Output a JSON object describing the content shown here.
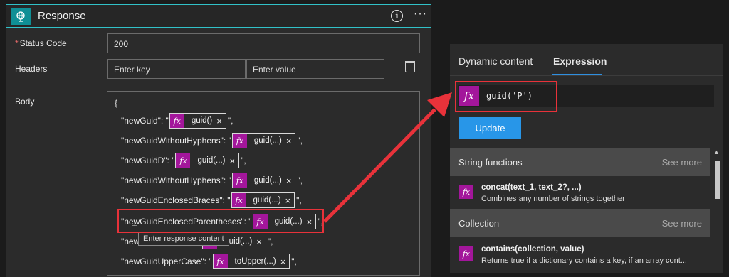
{
  "response_card": {
    "title": "Response",
    "info_label": "i",
    "more_label": "···",
    "status_code": {
      "label": "Status Code",
      "required_mark": "*",
      "value": "200"
    },
    "headers": {
      "label": "Headers",
      "key_placeholder": "Enter key",
      "value_placeholder": "Enter value"
    },
    "body": {
      "label": "Body",
      "open_brace": "{",
      "lines": [
        {
          "key": "\"newGuid\": \"",
          "token": "guid()",
          "suffix": "\","
        },
        {
          "key": "\"newGuidWithoutHyphens\": \"",
          "token": "guid(...)",
          "suffix": "\","
        },
        {
          "key": "\"newGuidD\": \"",
          "token": "guid(...)",
          "suffix": "\","
        },
        {
          "key": "\"newGuidWithoutHyphens\": \"",
          "token": "guid(...)",
          "suffix": "\","
        },
        {
          "key": "\"newGuidEnclosedBraces\": \"",
          "token": "guid(...)",
          "suffix": "\","
        },
        {
          "key": "\"newGuidEnclosedParentheses\": \"",
          "token": "guid(...)",
          "suffix": "\","
        },
        {
          "key": "\"new",
          "token": "guid(...)",
          "suffix": "\","
        },
        {
          "key": "\"newGuidUpperCase\": \"",
          "token": "toUpper(...)",
          "suffix": "\","
        }
      ],
      "tooltip": "Enter response content",
      "fx_label": "fx",
      "remove_label": "×"
    }
  },
  "expression_panel": {
    "tabs": [
      "Dynamic content",
      "Expression"
    ],
    "active_tab": "Expression",
    "expression": "guid('P')",
    "fx_label": "fx",
    "update_label": "Update",
    "sections": [
      {
        "title": "String functions",
        "see_more": "See more",
        "items": [
          {
            "name": "concat(text_1, text_2?, ...)",
            "desc": "Combines any number of strings together"
          }
        ]
      },
      {
        "title": "Collection",
        "see_more": "See more",
        "items": [
          {
            "name": "contains(collection, value)",
            "desc": "Returns true if a dictionary contains a key, if an array cont..."
          }
        ]
      }
    ]
  },
  "colors": {
    "accent_teal": "#31c1c8",
    "fx_magenta": "#a3169b",
    "update_blue": "#2896e8",
    "highlight_red": "#e8323a"
  }
}
